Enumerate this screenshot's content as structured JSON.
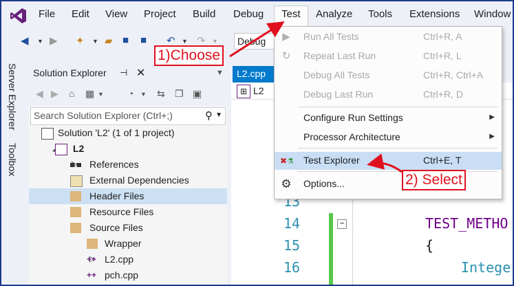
{
  "menubar": {
    "items": [
      "File",
      "Edit",
      "View",
      "Project",
      "Build",
      "Debug",
      "Test",
      "Analyze",
      "Tools",
      "Extensions",
      "Window"
    ]
  },
  "toolbar": {
    "config_combo": "Debug"
  },
  "side_tabs": [
    "Server Explorer",
    "Toolbox"
  ],
  "solution_explorer": {
    "title": "Solution Explorer",
    "pin_glyph": "⊣",
    "close_glyph": "✕",
    "search_placeholder": "Search Solution Explorer (Ctrl+;)",
    "tree": [
      {
        "label": "Solution 'L2' (1 of 1 project)",
        "indent": 0,
        "arrow": "",
        "icon": "solution-icon"
      },
      {
        "label": "L2",
        "indent": 1,
        "arrow": "◢",
        "icon": "project-icon",
        "bold": true
      },
      {
        "label": "References",
        "indent": 2,
        "arrow": "▷",
        "icon": "references-icon"
      },
      {
        "label": "External Dependencies",
        "indent": 2,
        "arrow": "▷",
        "icon": "external-dependencies-icon"
      },
      {
        "label": "Header Files",
        "indent": 2,
        "arrow": "▷",
        "icon": "folder-icon",
        "selected": true
      },
      {
        "label": "Resource Files",
        "indent": 2,
        "arrow": "",
        "icon": "folder-icon"
      },
      {
        "label": "Source Files",
        "indent": 2,
        "arrow": "◢",
        "icon": "folder-icon"
      },
      {
        "label": "Wrapper",
        "indent": 3,
        "arrow": "▷",
        "icon": "folder-icon"
      },
      {
        "label": "L2.cpp",
        "indent": 3,
        "arrow": "▷",
        "icon": "cpp-file-icon"
      },
      {
        "label": "pch.cpp",
        "indent": 3,
        "arrow": "",
        "icon": "cpp-file-icon"
      }
    ]
  },
  "editor": {
    "tab_label": "L2.cpp",
    "nav_label": "L2",
    "lines": [
      {
        "number": "13",
        "code": ""
      },
      {
        "number": "14",
        "code": "TEST_METHO"
      },
      {
        "number": "15",
        "code": "{"
      },
      {
        "number": "16",
        "code": "Intege"
      }
    ]
  },
  "test_menu": {
    "items": [
      {
        "label": "Run All Tests",
        "shortcut": "Ctrl+R, A",
        "disabled": true,
        "icon": "run-all-icon"
      },
      {
        "label": "Repeat Last Run",
        "shortcut": "Ctrl+R, L",
        "disabled": true,
        "icon": "repeat-icon"
      },
      {
        "label": "Debug All Tests",
        "shortcut": "Ctrl+R, Ctrl+A",
        "disabled": true,
        "icon": ""
      },
      {
        "label": "Debug Last Run",
        "shortcut": "Ctrl+R, D",
        "disabled": true,
        "icon": ""
      },
      {
        "label": "Configure Run Settings",
        "shortcut": "",
        "submenu": true,
        "icon": ""
      },
      {
        "label": "Processor Architecture",
        "shortcut": "",
        "submenu": true,
        "icon": ""
      },
      {
        "label": "Test Explorer",
        "shortcut": "Ctrl+E, T",
        "highlighted": true,
        "icon": "test-explorer-icon"
      },
      {
        "label": "Options...",
        "shortcut": "",
        "icon": "gear-icon"
      }
    ]
  },
  "annotations": {
    "choose": "1)Choose",
    "select": "2) Select"
  },
  "colors": {
    "accent": "#007acc",
    "callout": "#e0101e",
    "highlight": "#c9def5",
    "change_bar": "#57c84a"
  }
}
